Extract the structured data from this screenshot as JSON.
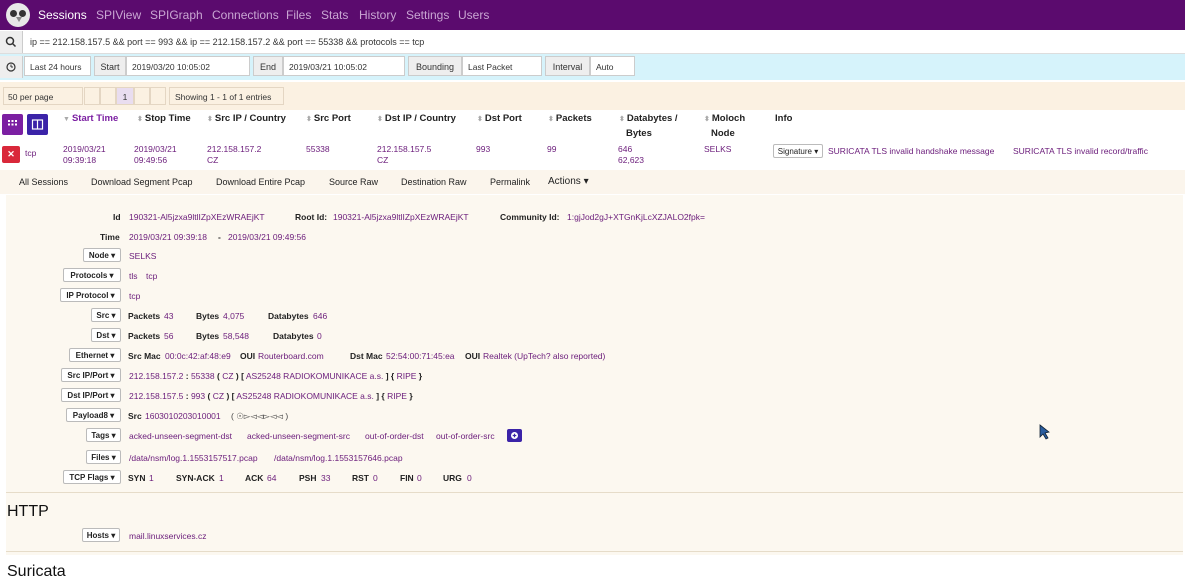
{
  "nav": {
    "items": [
      "Sessions",
      "SPIView",
      "SPIGraph",
      "Connections",
      "Files",
      "Stats",
      "History",
      "Settings",
      "Users"
    ]
  },
  "search": {
    "query": "ip == 212.158.157.5 && port == 993 && ip == 212.158.157.2 && port == 55338 && protocols == tcp"
  },
  "time": {
    "range": "Last 24 hours",
    "start_label": "Start",
    "start_value": "2019/03/20 10:05:02",
    "end_label": "End",
    "end_value": "2019/03/21 10:05:02",
    "bounding_label": "Bounding",
    "bounding_value": "Last Packet",
    "interval_label": "Interval",
    "interval_value": "Auto"
  },
  "paging": {
    "per_page": "50 per page",
    "current_page": "1",
    "showing": "Showing 1 - 1 of 1 entries"
  },
  "table": {
    "headers": {
      "start_time": "Start Time",
      "stop_time": "Stop Time",
      "src_ip_country": "Src IP / Country",
      "src_port": "Src Port",
      "dst_ip_country": "Dst IP / Country",
      "dst_port": "Dst Port",
      "packets": "Packets",
      "databytes_1": "Databytes /",
      "databytes_2": "Bytes",
      "moloch_1": "Moloch",
      "moloch_2": "Node",
      "info": "Info"
    },
    "row": {
      "protocol": "tcp",
      "start_date": "2019/03/21",
      "start_time": "09:39:18",
      "stop_date": "2019/03/21",
      "stop_time": "09:49:56",
      "src_ip": "212.158.157.2",
      "src_country": "CZ",
      "src_port": "55338",
      "dst_ip": "212.158.157.5",
      "dst_country": "CZ",
      "dst_port": "993",
      "packets": "99",
      "databytes": "646",
      "bytes": "62,623",
      "node": "SELKS",
      "info_dropdown": "Signature",
      "info_1": "SURICATA TLS invalid handshake message",
      "info_2": "SURICATA TLS invalid record/traffic"
    }
  },
  "actions": [
    "All Sessions",
    "Download Segment Pcap",
    "Download Entire Pcap",
    "Source Raw",
    "Destination Raw",
    "Permalink",
    "Actions"
  ],
  "detail": {
    "id_label": "Id",
    "id_value": "190321-Al5jzxa9ltlIZpXEzWRAEjKT",
    "root_id_label": "Root Id:",
    "root_id_value": "190321-Al5jzxa9ltlIZpXEzWRAEjKT",
    "community_id_label": "Community Id:",
    "community_id_value": "1:gjJod2gJ+XTGnKjLcXZJALO2fpk=",
    "time_label": "Time",
    "time_start": "2019/03/21 09:39:18",
    "time_sep": "-",
    "time_end": "2019/03/21 09:49:56",
    "node_label": "Node",
    "node_value": "SELKS",
    "protocols_label": "Protocols",
    "protocols": [
      "tls",
      "tcp"
    ],
    "ip_protocol_label": "IP Protocol",
    "ip_protocol_value": "tcp",
    "src_label": "Src",
    "src_packets_label": "Packets",
    "src_packets": "43",
    "src_bytes_label": "Bytes",
    "src_bytes": "4,075",
    "src_databytes_label": "Databytes",
    "src_databytes": "646",
    "dst_label": "Dst",
    "dst_packets_label": "Packets",
    "dst_packets": "56",
    "dst_bytes_label": "Bytes",
    "dst_bytes": "58,548",
    "dst_databytes_label": "Databytes",
    "dst_databytes": "0",
    "ethernet_label": "Ethernet",
    "src_mac_label": "Src Mac",
    "src_mac": "00:0c:42:af:48:e9",
    "oui_label": "OUI",
    "src_oui": "Routerboard.com",
    "dst_mac_label": "Dst Mac",
    "dst_mac": "52:54:00:71:45:ea",
    "dst_oui": "Realtek (UpTech? also reported)",
    "src_ipport_label": "Src IP/Port",
    "src_ip": "212.158.157.2",
    "src_port": "55338",
    "src_country": "CZ",
    "src_asn": "AS25248 RADIOKOMUNIKACE a.s.",
    "src_rir": "RIPE",
    "dst_ipport_label": "Dst IP/Port",
    "dst_ip": "212.158.157.5",
    "dst_port": "993",
    "dst_country": "CZ",
    "dst_asn": "AS25248 RADIOKOMUNIKACE a.s.",
    "dst_rir": "RIPE",
    "payload_label": "Payload8",
    "payload_src_label": "Src",
    "payload_src_value": "1603010203010001",
    "payload_src_ascii": "( ☉▻◅◅▻◅◅ )",
    "tags_label": "Tags",
    "tags": [
      "acked-unseen-segment-dst",
      "acked-unseen-segment-src",
      "out-of-order-dst",
      "out-of-order-src"
    ],
    "files_label": "Files",
    "files": [
      "/data/nsm/log.1.1553157517.pcap",
      "/data/nsm/log.1.1553157646.pcap"
    ],
    "tcp_flags_label": "TCP Flags",
    "flags": [
      {
        "name": "SYN",
        "value": "1"
      },
      {
        "name": "SYN-ACK",
        "value": "1"
      },
      {
        "name": "ACK",
        "value": "64"
      },
      {
        "name": "PSH",
        "value": "33"
      },
      {
        "name": "RST",
        "value": "0"
      },
      {
        "name": "FIN",
        "value": "0"
      },
      {
        "name": "URG",
        "value": "0"
      }
    ]
  },
  "http": {
    "title": "HTTP",
    "hosts_label": "Hosts",
    "host": "mail.linuxservices.cz"
  },
  "suricata": {
    "title": "Suricata"
  },
  "colors": {
    "nav_bg": "#5b0b6e",
    "link": "#6a1b7a",
    "time_bar_bg": "#d6f3fb",
    "detail_bg": "#fcf8f0",
    "close_button": "#d9283a",
    "view_button": "#3b23a8"
  }
}
